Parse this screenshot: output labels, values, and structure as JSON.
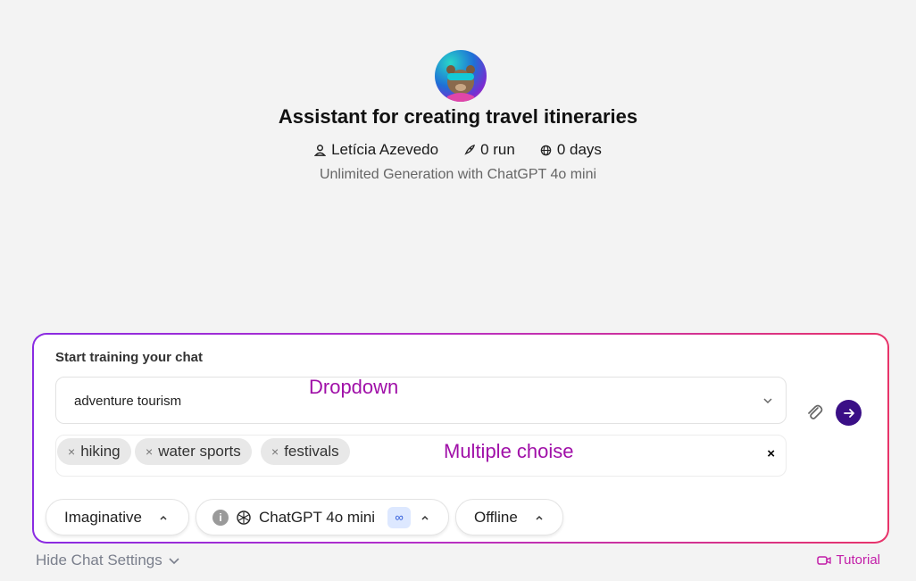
{
  "header": {
    "title": "Assistant for creating travel itineraries",
    "author": "Letícia Azevedo",
    "runs": "0 run",
    "days": "0 days",
    "subtitle": "Unlimited Generation with ChatGPT 4o mini"
  },
  "panel": {
    "heading": "Start training your chat",
    "dropdown_value": "adventure tourism",
    "dropdown_annotation": "Dropdown",
    "multi_annotation": "Multiple choise",
    "chips": [
      "hiking",
      "water sports",
      "festivals"
    ],
    "chip_remove_glyph": "×",
    "clear_glyph": "×"
  },
  "settings": {
    "creativity": "Imaginative",
    "model": "ChatGPT 4o mini",
    "model_badge": "∞",
    "info_glyph": "i",
    "mode": "Offline"
  },
  "footer": {
    "hide_label": "Hide Chat Settings",
    "tutorial_label": "Tutorial"
  },
  "colors": {
    "accent": "#3a0f86",
    "gradient_start": "#8a2be2",
    "gradient_end": "#e8346a",
    "annotation": "#a010a8",
    "tutorial": "#c21da8"
  },
  "icons": [
    "user-icon",
    "rocket-icon",
    "globe-icon",
    "chevron-down-icon",
    "close-icon",
    "paperclip-icon",
    "arrow-right-icon",
    "info-icon",
    "openai-icon",
    "chevron-up-icon",
    "video-icon"
  ]
}
